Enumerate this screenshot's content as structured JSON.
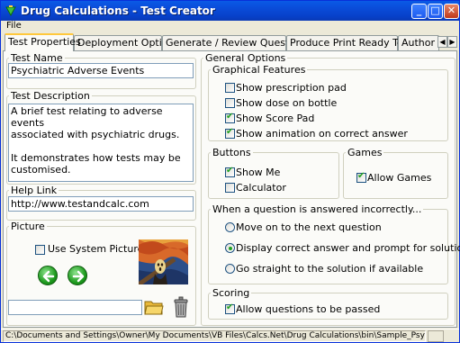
{
  "window": {
    "title": "Drug Calculations - Test Creator",
    "min_glyph": "_",
    "max_glyph": "□",
    "close_glyph": "✕"
  },
  "menu": {
    "file": "File"
  },
  "tabs": [
    {
      "label": "Test Properties",
      "active": true
    },
    {
      "label": "Deployment Options"
    },
    {
      "label": "Generate / Review Questions"
    },
    {
      "label": "Produce Print Ready Test"
    },
    {
      "label": "Author D"
    }
  ],
  "tab_scroll": {
    "left": "◀",
    "right": "▶"
  },
  "test_name": {
    "legend": "Test Name",
    "value": "Psychiatric Adverse Events"
  },
  "test_description": {
    "legend": "Test Description",
    "value": "A brief test relating to adverse events\nassociated with psychiatric drugs.\n\nIt demonstrates how tests may be\ncustomised."
  },
  "help_link": {
    "legend": "Help Link",
    "value": "http://www.testandcalc.com"
  },
  "picture": {
    "legend": "Picture",
    "use_system_picture": {
      "label": "Use System Picture",
      "checked": false
    },
    "path_value": ""
  },
  "general_options": {
    "legend": "General Options",
    "graphical_features": {
      "legend": "Graphical Features",
      "items": [
        {
          "label": "Show prescription pad",
          "checked": false
        },
        {
          "label": "Show dose on bottle",
          "checked": false
        },
        {
          "label": "Show Score Pad",
          "checked": true
        },
        {
          "label": "Show animation on correct answer",
          "checked": true
        }
      ]
    },
    "buttons": {
      "legend": "Buttons",
      "items": [
        {
          "label": "Show Me",
          "checked": true
        },
        {
          "label": "Calculator",
          "checked": false
        }
      ]
    },
    "games": {
      "legend": "Games",
      "items": [
        {
          "label": "Allow Games",
          "checked": true
        }
      ]
    },
    "incorrect": {
      "legend": "When a question is answered incorrectly...",
      "options": [
        {
          "label": "Move on to the next question",
          "selected": false
        },
        {
          "label": "Display correct answer and prompt for solution",
          "selected": true
        },
        {
          "label": "Go straight to the solution if available",
          "selected": false
        }
      ]
    },
    "scoring": {
      "legend": "Scoring",
      "items": [
        {
          "label": "Allow questions to be passed",
          "checked": true
        }
      ]
    }
  },
  "status_bar": {
    "path": "C:\\Documents and Settings\\Owner\\My Documents\\VB Files\\Calcs.Net\\Drug Calculations\\bin\\Sample_Psych.dct"
  },
  "colors": {
    "title_bar": "#0a4bd8",
    "tab_highlight": "#ffc83c",
    "accent_green": "#21a121"
  }
}
